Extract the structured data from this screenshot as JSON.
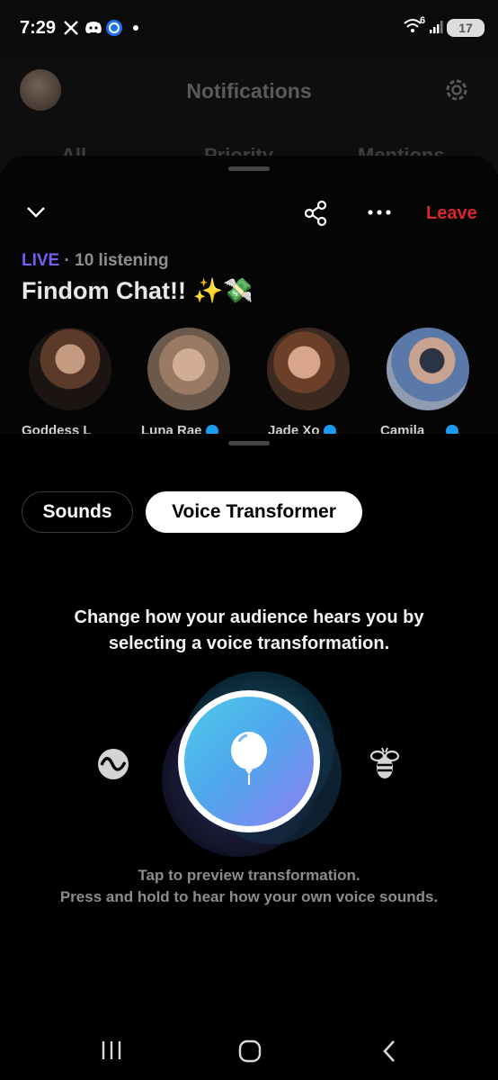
{
  "status_bar": {
    "time": "7:29",
    "battery": "17",
    "signal_superscript": "6",
    "icons": [
      "x-icon",
      "discord-icon",
      "bluesky-icon",
      "dot-icon",
      "wifi-icon",
      "signal-icon",
      "battery-icon"
    ]
  },
  "background_page": {
    "title": "Notifications",
    "tabs": [
      "All",
      "Priority",
      "Mentions"
    ]
  },
  "space": {
    "leave_label": "Leave",
    "live_label": "LIVE",
    "listening": "· 10 listening",
    "title": "Findom Chat!! ✨💸",
    "speakers": [
      {
        "name": "Goddess L",
        "verified": false
      },
      {
        "name": "Luna Rae",
        "verified": true
      },
      {
        "name": "Jade Xo",
        "verified": true
      },
      {
        "name": "Camila",
        "verified": true
      }
    ]
  },
  "tabs": {
    "sounds": "Sounds",
    "voice_transformer": "Voice Transformer",
    "selected": "Voice Transformer"
  },
  "voice": {
    "description_line1": "Change how your audience hears you by",
    "description_line2": "selecting a voice transformation.",
    "hint_line1": "Tap to preview transformation.",
    "hint_line2": "Press and hold to hear how your own voice sounds.",
    "options": [
      "wave-icon",
      "balloon-icon",
      "bee-icon"
    ],
    "selected_option": "balloon-icon"
  },
  "colors": {
    "live": "#7a5cf5",
    "leave": "#d9262b",
    "verified": "#1d9bf0",
    "accent_orb": "#3aa6e8"
  },
  "navbar": [
    "recent-apps-icon",
    "home-icon",
    "back-icon"
  ]
}
